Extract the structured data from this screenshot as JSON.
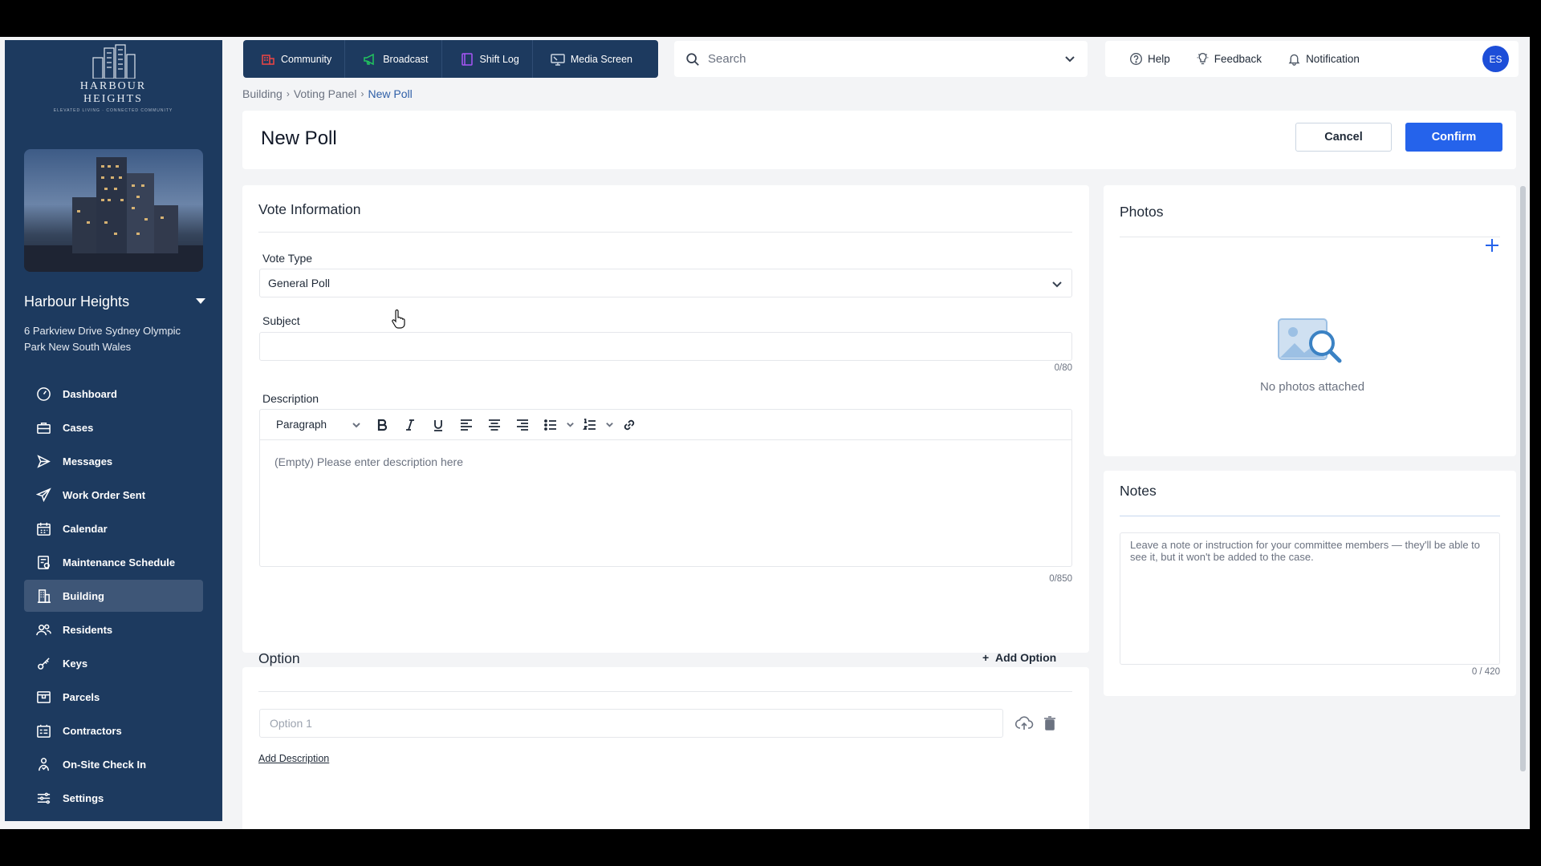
{
  "brand": {
    "logo_name": "HARBOUR HEIGHTS",
    "logo_tagline": "ELEVATED LIVING · CONNECTED COMMUNITY"
  },
  "property": {
    "name": "Harbour Heights",
    "address": "6 Parkview Drive Sydney Olympic Park New South Wales"
  },
  "sidebar": {
    "items": [
      {
        "label": "Dashboard",
        "icon": "dashboard-icon"
      },
      {
        "label": "Cases",
        "icon": "briefcase-icon"
      },
      {
        "label": "Messages",
        "icon": "send-icon"
      },
      {
        "label": "Work Order Sent",
        "icon": "paper-plane-icon"
      },
      {
        "label": "Calendar",
        "icon": "calendar-icon"
      },
      {
        "label": "Maintenance Schedule",
        "icon": "schedule-icon"
      },
      {
        "label": "Building",
        "icon": "building-icon",
        "active": true
      },
      {
        "label": "Residents",
        "icon": "residents-icon"
      },
      {
        "label": "Keys",
        "icon": "key-icon"
      },
      {
        "label": "Parcels",
        "icon": "parcel-icon"
      },
      {
        "label": "Contractors",
        "icon": "contractors-icon"
      },
      {
        "label": "On-Site Check In",
        "icon": "check-in-icon"
      },
      {
        "label": "Settings",
        "icon": "settings-icon"
      }
    ]
  },
  "topnav": {
    "tabs": [
      {
        "label": "Community",
        "icon": "community-icon",
        "color": "#ef4444"
      },
      {
        "label": "Broadcast",
        "icon": "megaphone-icon",
        "color": "#22c55e"
      },
      {
        "label": "Shift Log",
        "icon": "log-icon",
        "color": "#a855f7"
      },
      {
        "label": "Media Screen",
        "icon": "monitor-icon",
        "color": "#9ca3af"
      }
    ]
  },
  "search": {
    "placeholder": "Search",
    "value": ""
  },
  "utility": {
    "help": "Help",
    "feedback": "Feedback",
    "notification": "Notification",
    "avatar_initials": "ES"
  },
  "breadcrumb": {
    "items": [
      "Building",
      "Voting Panel",
      "New Poll"
    ]
  },
  "header": {
    "title": "New Poll",
    "cancel_label": "Cancel",
    "confirm_label": "Confirm"
  },
  "vote_info": {
    "title": "Vote Information",
    "vote_type_label": "Vote Type",
    "vote_type_value": "General Poll",
    "subject_label": "Subject",
    "subject_value": "",
    "subject_counter": "0/80",
    "description_label": "Description",
    "paragraph_style": "Paragraph",
    "description_placeholder": "(Empty) Please enter description here",
    "description_counter": "0/850"
  },
  "option": {
    "title": "Option",
    "add_label": "Add Option",
    "option_placeholder": "Option 1",
    "add_description": "Add Description"
  },
  "photos": {
    "title": "Photos",
    "empty_text": "No photos attached"
  },
  "notes": {
    "title": "Notes",
    "placeholder": "Leave a note or instruction for your committee members — they'll be able to see it, but it won't be added to the case.",
    "counter": "0 / 420"
  },
  "colors": {
    "sidebar_bg": "#1d3a5f",
    "accent": "#2563eb",
    "breadcrumb_current": "#2f5fa7"
  }
}
